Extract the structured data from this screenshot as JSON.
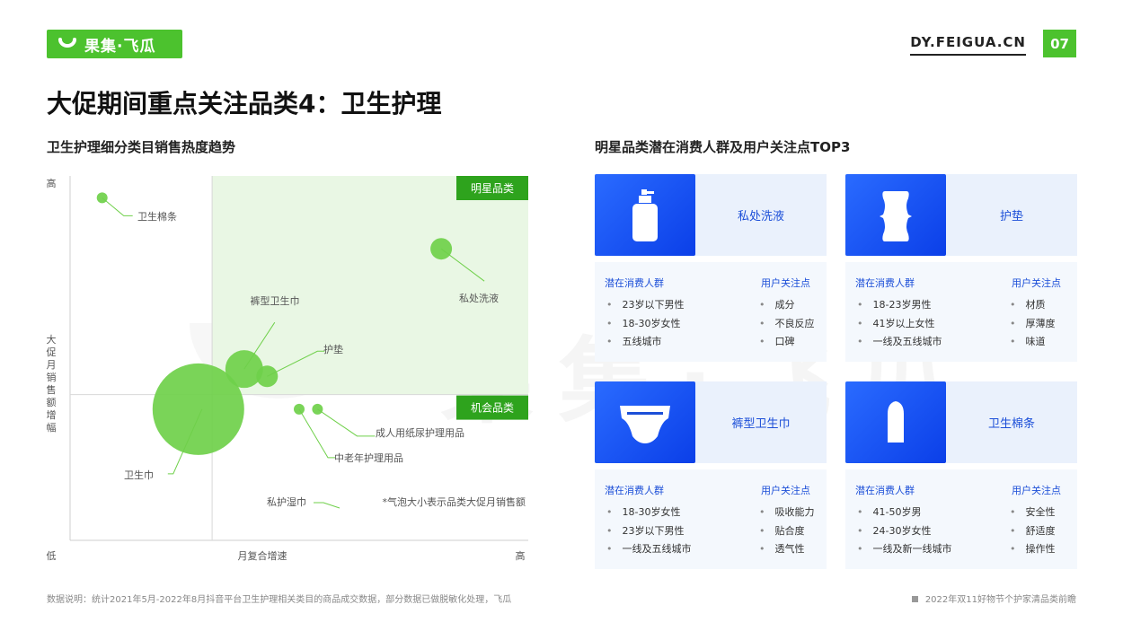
{
  "header": {
    "logo_text": "果集·飞瓜",
    "site_url": "DY.FEIGUA.CN",
    "page_number": "07",
    "accent_color": "#4cc22e"
  },
  "page_title": "大促期间重点关注品类4：卫生护理",
  "left_section_title": "卫生护理细分类目销售热度趋势",
  "right_section_title": "明星品类潜在消费人群及用户关注点TOP3",
  "chart_data": {
    "type": "scatter",
    "subtype": "bubble-quadrant",
    "x_label": "月复合增速",
    "y_label": "大促月销售额增幅",
    "x_low": "低",
    "x_high": "高",
    "y_high": "高",
    "quadrant_star_label": "明星品类",
    "quadrant_opportunity_label": "机会品类",
    "bubble_note": "*气泡大小表示品类大促月销售额",
    "xlim": [
      0,
      100
    ],
    "ylim": [
      0,
      100
    ],
    "x_divider": 31,
    "y_divider": 40,
    "points": [
      {
        "name": "卫生棉条",
        "x": 7,
        "y": 94,
        "size": 1
      },
      {
        "name": "私处洗液",
        "x": 81,
        "y": 80,
        "size": 3
      },
      {
        "name": "裤型卫生巾",
        "x": 38,
        "y": 47,
        "size": 6
      },
      {
        "name": "护垫",
        "x": 43,
        "y": 45,
        "size": 3
      },
      {
        "name": "卫生巾",
        "x": 28,
        "y": 36,
        "size": 16
      },
      {
        "name": "中老年护理用品",
        "x": 50,
        "y": 36,
        "size": 1
      },
      {
        "name": "成人用纸尿护理用品",
        "x": 54,
        "y": 36,
        "size": 1
      }
    ],
    "labels": {
      "卫生棉条": "卫生棉条",
      "私处洗液": "私处洗液",
      "裤型卫生巾": "裤型卫生巾",
      "护垫": "护垫",
      "卫生巾": "卫生巾",
      "中老年护理用品": "中老年护理用品",
      "成人用纸尿护理用品": "成人用纸尿护理用品",
      "私护湿巾": "私护湿巾"
    },
    "colors": {
      "bubble": "#6fd04a",
      "star_bg": "#e9f7e4",
      "quadrant_tag": "#2ea31d"
    }
  },
  "cards": [
    {
      "name": "私处洗液",
      "icon": "bottle-icon",
      "audience_title": "潜在消费人群",
      "focus_title": "用户关注点",
      "audience": [
        "23岁以下男性",
        "18-30岁女性",
        "五线城市"
      ],
      "focus": [
        "成分",
        "不良反应",
        "口碑"
      ]
    },
    {
      "name": "护垫",
      "icon": "pantyliner-icon",
      "audience_title": "潜在消费人群",
      "focus_title": "用户关注点",
      "audience": [
        "18-23岁男性",
        "41岁以上女性",
        "一线及五线城市"
      ],
      "focus": [
        "材质",
        "厚薄度",
        "味道"
      ]
    },
    {
      "name": "裤型卫生巾",
      "icon": "pants-pad-icon",
      "audience_title": "潜在消费人群",
      "focus_title": "用户关注点",
      "audience": [
        "18-30岁女性",
        "23岁以下男性",
        "一线及五线城市"
      ],
      "focus": [
        "吸收能力",
        "贴合度",
        "透气性"
      ]
    },
    {
      "name": "卫生棉条",
      "icon": "tampon-icon",
      "audience_title": "潜在消费人群",
      "focus_title": "用户关注点",
      "audience": [
        "41-50岁男",
        "24-30岁女性",
        "一线及新一线城市"
      ],
      "focus": [
        "安全性",
        "舒适度",
        "操作性"
      ]
    }
  ],
  "watermark_text": "果集·飞瓜",
  "footer": {
    "note": "数据说明：统计2021年5月-2022年8月抖音平台卫生护理相关类目的商品成交数据，部分数据已做脱敏化处理，飞瓜",
    "report": "2022年双11好物节个护家清品类前瞻"
  }
}
